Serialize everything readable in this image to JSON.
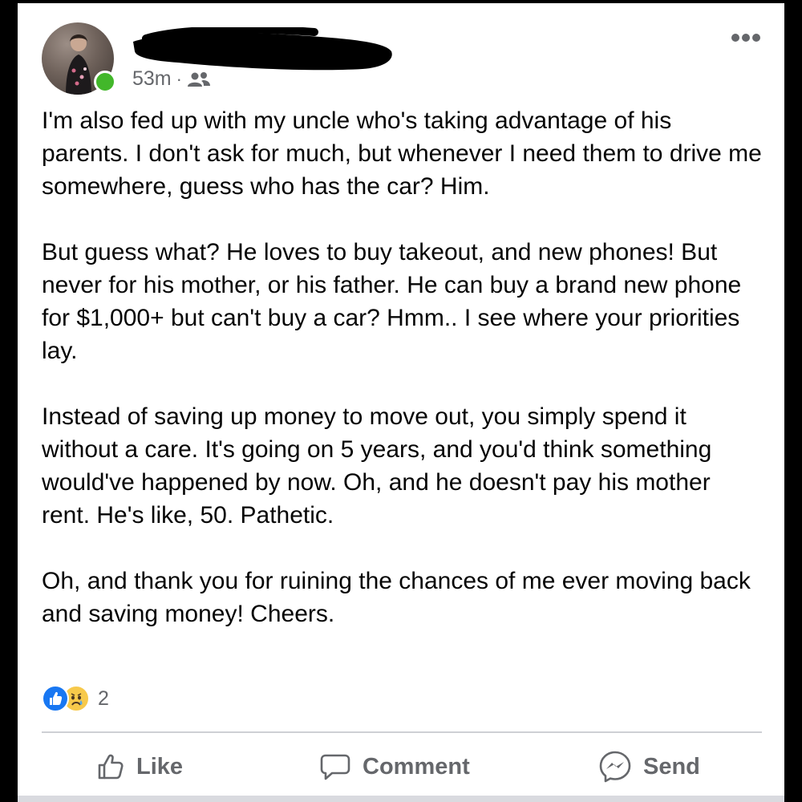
{
  "post": {
    "timestamp": "53m",
    "separator": "·",
    "audience_icon": "friends-icon",
    "paragraphs": [
      "I'm also fed up with my uncle who's taking advantage of his parents. I don't ask for much, but whenever I need them to drive me somewhere, guess who has the car? Him.",
      "But guess what? He loves to buy takeout, and new phones! But never for his mother, or his father. He can buy a brand new phone for $1,000+ but can't buy a car? Hmm.. I see where your priorities lay.",
      "Instead of saving up money to move out, you simply spend it without a care. It's going on 5 years, and you'd think something would've happened by now. Oh, and he doesn't pay his mother rent. He's like, 50. Pathetic.",
      "Oh, and thank you for ruining the chances of me ever moving back and saving money! Cheers."
    ]
  },
  "reactions": {
    "types": [
      "like",
      "sad"
    ],
    "count": "2"
  },
  "actions": {
    "like_label": "Like",
    "comment_label": "Comment",
    "send_label": "Send"
  },
  "colors": {
    "online": "#42b72a",
    "like_blue": "#1877f2",
    "sad_yellow": "#f7c94b",
    "secondary_text": "#65676b",
    "primary_text": "#050505"
  }
}
